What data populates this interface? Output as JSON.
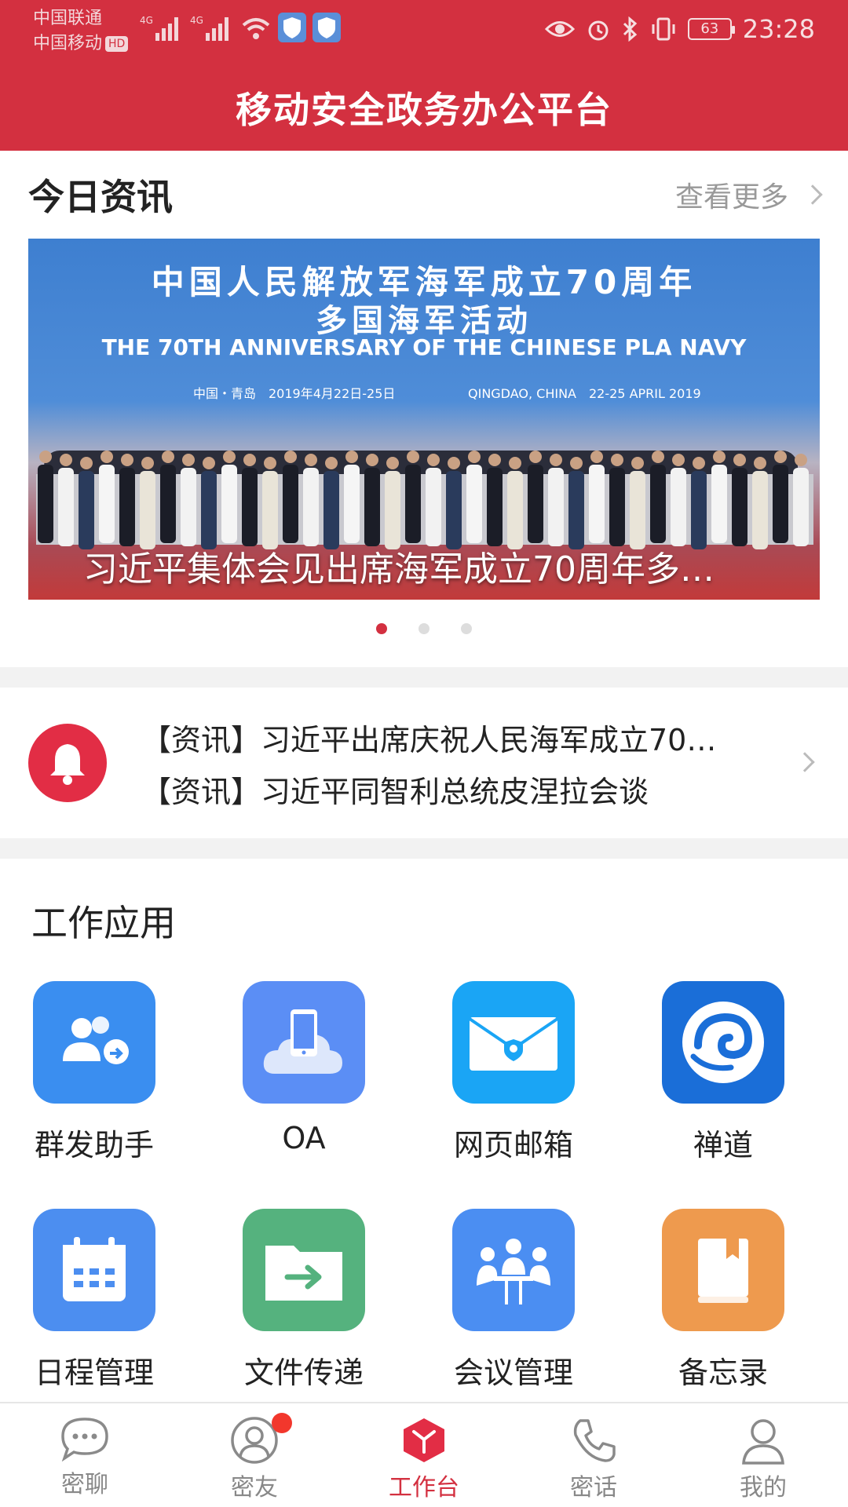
{
  "status_bar": {
    "carrier_1": "中国联通",
    "carrier_2": "中国移动",
    "hd": "HD",
    "net_1": "4G",
    "net_2": "4G",
    "battery": "63",
    "time": "23:28"
  },
  "header": {
    "title": "移动安全政务办公平台"
  },
  "news": {
    "title": "今日资讯",
    "more_label": "查看更多",
    "banner": {
      "line1": "中国人民解放军海军成立70周年",
      "line2": "多国海军活动",
      "line3": "THE 70TH ANNIVERSARY OF THE CHINESE PLA NAVY",
      "line4": "中国・青岛　2019年4月22日-25日",
      "line5": "QINGDAO, CHINA　22-25 APRIL 2019",
      "caption": "习近平集体会见出席海军成立70周年多…"
    },
    "carousel": {
      "count": 3,
      "active_index": 0
    }
  },
  "notice": {
    "items": [
      "【资讯】习近平出席庆祝人民海军成立70…",
      "【资讯】习近平同智利总统皮涅拉会谈"
    ]
  },
  "apps": {
    "title": "工作应用",
    "items": [
      {
        "label": "群发助手",
        "icon": "group-send-icon",
        "color": "#3a8ef0"
      },
      {
        "label": "OA",
        "icon": "oa-phone-cloud-icon",
        "color": "#5b8ef5"
      },
      {
        "label": "网页邮箱",
        "icon": "web-mail-icon",
        "color": "#1aa5f5"
      },
      {
        "label": "禅道",
        "icon": "zentao-swirl-icon",
        "color": "#1a6ed8"
      },
      {
        "label": "日程管理",
        "icon": "calendar-icon",
        "color": "#4c8ef0"
      },
      {
        "label": "文件传递",
        "icon": "folder-transfer-icon",
        "color": "#55b27e"
      },
      {
        "label": "会议管理",
        "icon": "meeting-icon",
        "color": "#4b8ef2"
      },
      {
        "label": "备忘录",
        "icon": "memo-book-icon",
        "color": "#ee9a4e"
      }
    ]
  },
  "tabbar": {
    "tabs": [
      {
        "label": "密聊",
        "icon": "chat-bubble-icon"
      },
      {
        "label": "密友",
        "icon": "contacts-icon",
        "badge": true
      },
      {
        "label": "工作台",
        "icon": "workbench-cube-icon",
        "active": true
      },
      {
        "label": "密话",
        "icon": "phone-icon"
      },
      {
        "label": "我的",
        "icon": "profile-icon"
      }
    ]
  },
  "colors": {
    "brand_red": "#d33040",
    "text_gray": "#888888"
  }
}
